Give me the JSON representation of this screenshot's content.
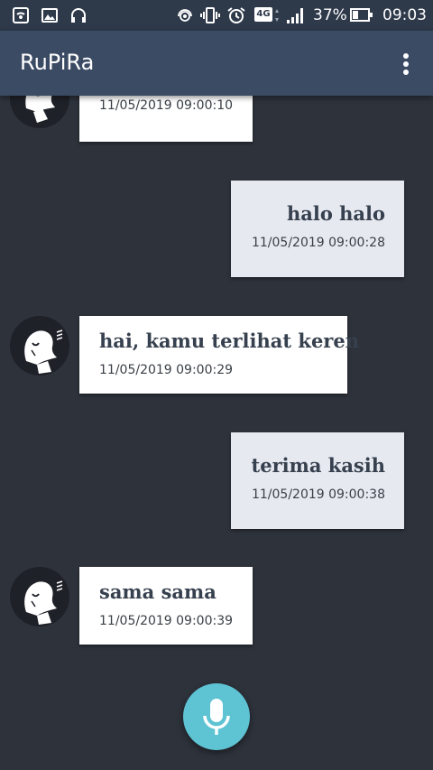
{
  "status_bar": {
    "battery": "37%",
    "battery_level": 0.37,
    "time": "09:03",
    "network": "4G",
    "left_icons": [
      "hotspot-icon",
      "image-icon",
      "headphones-icon"
    ],
    "right_icons": [
      "wireless-icon",
      "vibrate-icon",
      "alarm-icon",
      "network-4g-icon",
      "signal-icon",
      "battery-icon"
    ]
  },
  "app_bar": {
    "title": "RuPiRa",
    "menu_icon": "more-vertical-icon"
  },
  "messages": [
    {
      "sender": "bot",
      "text": "",
      "time": "11/05/2019 09:00:10"
    },
    {
      "sender": "user",
      "text": "halo halo",
      "time": "11/05/2019 09:00:28"
    },
    {
      "sender": "bot",
      "text": "hai, kamu terlihat keren",
      "time": "11/05/2019 09:00:29"
    },
    {
      "sender": "user",
      "text": "terima kasih",
      "time": "11/05/2019 09:00:38"
    },
    {
      "sender": "bot",
      "text": "sama sama",
      "time": "11/05/2019 09:00:39"
    }
  ],
  "fab": {
    "icon": "microphone-icon"
  },
  "colors": {
    "background": "#2e323b",
    "app_bar": "#3c4b64",
    "bot_bubble": "#ffffff",
    "user_bubble": "#e6e9f0",
    "fab": "#5ec3d3"
  }
}
